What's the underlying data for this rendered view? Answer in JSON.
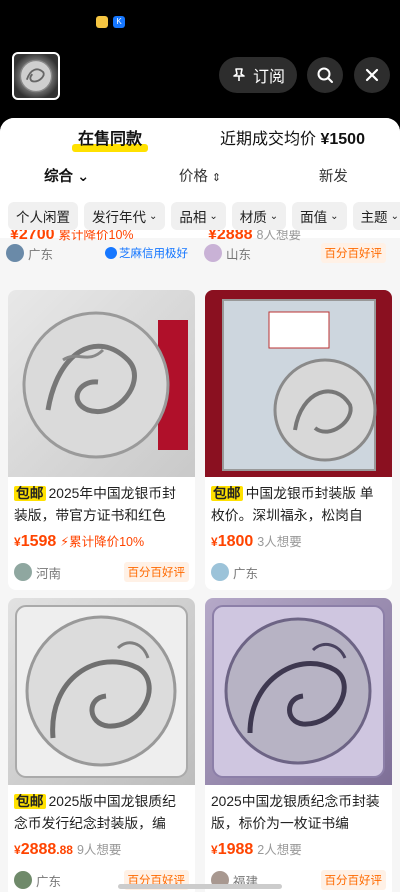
{
  "header": {
    "subscribe_label": "订阅",
    "search_icon": "search-icon",
    "close_icon": "close-icon"
  },
  "summary": {
    "tab_label": "在售同款",
    "avg_label": "近期成交均价",
    "avg_price": "¥1500"
  },
  "sort": {
    "items": [
      "综合",
      "价格",
      "新发"
    ]
  },
  "filters": [
    "个人闲置",
    "发行年代",
    "品相",
    "材质",
    "面值",
    "主题"
  ],
  "cut_row": {
    "left_price": "¥2700",
    "left_drop": "累计降价10%",
    "left_location": "广东",
    "left_credit": "芝麻信用极好",
    "right_price": "¥2888",
    "right_want": "8人想要",
    "right_location": "山东",
    "right_badge": "百分百好评"
  },
  "cards": [
    {
      "tag": "包邮",
      "title": "2025年中国龙银币封装版，带官方证书和红色",
      "price": "1598",
      "price_dec": "",
      "drop": "累计降价10%",
      "want": "",
      "location": "河南",
      "badge": "百分百好评"
    },
    {
      "tag": "包邮",
      "title": "中国龙银币封装版 单枚价。深圳福永，松岗自",
      "price": "1800",
      "price_dec": "",
      "drop": "",
      "want": "3人想要",
      "location": "广东",
      "badge": ""
    },
    {
      "tag": "包邮",
      "title": "2025版中国龙银质纪念币发行纪念封装版，编",
      "price": "2888",
      "price_dec": ".88",
      "drop": "",
      "want": "9人想要",
      "location": "广东",
      "badge": "百分百好评"
    },
    {
      "tag": "",
      "title": "2025中国龙银质纪念币封装版，标价为一枚证书编",
      "price": "1988",
      "price_dec": "",
      "drop": "",
      "want": "2人想要",
      "location": "福建",
      "badge": "百分百好评"
    }
  ],
  "colors": {
    "accent": "#ffe100",
    "price": "#ff4400"
  }
}
